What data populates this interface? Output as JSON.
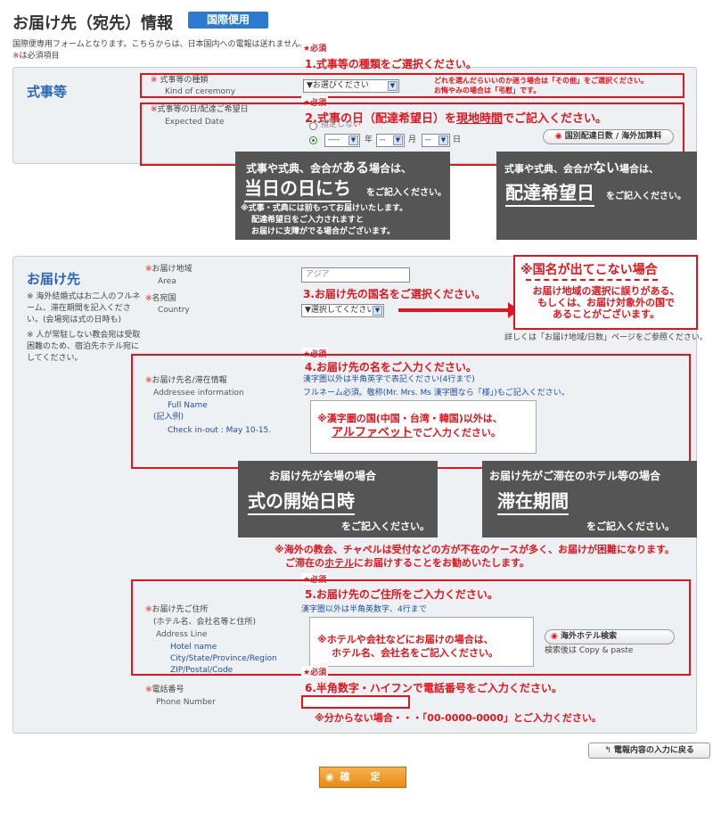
{
  "header": {
    "title": "お届け先（宛先）情報",
    "badge": "国際便用",
    "description": "国際便専用フォームとなります。こちらからは、日本国内への電報は送れません。",
    "required_mark": "※",
    "required_note": "は必須項目"
  },
  "ceremony_section": {
    "title": "式事等",
    "kind": {
      "mark": "※",
      "label": "式事等の種類",
      "label_en": "Kind of ceremony",
      "select_value": "▼お選びください",
      "hint_line1": "どれを選んだらいいのか迷う場合は「その他」をご選択ください。",
      "hint_line2": "お悔やみの場合は「弔慰」です。"
    },
    "date": {
      "mark": "※",
      "label": "式事等の日/配達ご希望日",
      "label_en": "Expected Date",
      "radio1_label": "指定しない",
      "year_value": "----",
      "year_unit": "年",
      "month_value": "--",
      "month_unit": "月",
      "day_value": "--",
      "day_unit": "日",
      "delivery_days_button": "国別配達日数 / 海外加算料"
    }
  },
  "annotations": {
    "hissu": "★必須",
    "step1": "1.式事等の種類をご選択ください。",
    "step2_a": "2.式事の日（配達希望日）を",
    "step2_b": "現地時間",
    "step2_c": "でご記入ください。",
    "box_a_line1_a": "式事や式典、会合が",
    "box_a_line1_b": "ある",
    "box_a_line1_c": "場合は、",
    "box_a_big": "当日の日にち",
    "box_a_small": "をご記入ください。",
    "box_a_note1": "※式事・式典には前もってお届けいたします。",
    "box_a_note2": "配達希望日をご入力されますと",
    "box_a_note3": "お届けに支障がでる場合がございます。",
    "box_b_line1_a": "式事や式典、会合が",
    "box_b_line1_b": "ない",
    "box_b_line1_c": "場合は、",
    "box_b_big": "配達希望日",
    "box_b_small": "をご記入ください。",
    "step3": "3.お届け先の国名をご選択ください。",
    "country_box_title": "※国名が出てこない場合",
    "country_box_line1": "お届け地域の選択に誤りがある、",
    "country_box_line2": "もしくは、お届け対象外の国で",
    "country_box_line3": "あることがございます。",
    "step4": "4.お届け先の名をご入力ください。",
    "kanji_note_a": "※漢字圏の国(中国・台湾・韓国)以外は、",
    "kanji_note_b": "アルファベット",
    "kanji_note_c": "でご入力ください。",
    "venue_title": "お届け先が会場の場合",
    "venue_big": "式の開始日時",
    "venue_small": "をご記入ください。",
    "hotel_title": "お届け先がご滞在のホテル等の場合",
    "hotel_big": "滞在期間",
    "hotel_small": "をご記入ください。",
    "church_note1": "※海外の教会、チャペルは受付などの方が不在のケースが多く、お届けが困難になります。",
    "church_note2_a": "ご滞在の",
    "church_note2_b": "ホテル",
    "church_note2_c": "にお届けすることをお勧めいたします。",
    "step5": "5.お届け先のご住所をご入力ください。",
    "address_note1": "※ホテルや会社などにお届けの場合は、",
    "address_note2": "ホテル名、会社名をご記入ください。",
    "step6": "6.半角数字・ハイフンで電話番号をご入力ください。",
    "phone_note": "※分からない場合・・・「00-0000-0000」とご入力ください。"
  },
  "destination_section": {
    "title": "お届け先",
    "side_note1": "※ 海外結婚式はお二人のフルネーム、滞在期間を記入ください。(会場宛は式の日時も)",
    "side_note2": "※ 人が常駐しない教会宛は受取困難のため、宿泊先ホテル宛にしてください。",
    "area": {
      "mark": "※",
      "label": "お届け地域",
      "label_en": "Area",
      "value": "アジア"
    },
    "country": {
      "mark": "※",
      "label": "名宛国",
      "label_en": "Country",
      "select_value": "▼選択してください",
      "link_text": "詳しくは「お届け地域/日数」ページをご参照ください。"
    },
    "addressee": {
      "mark": "※",
      "label": "お届け先名/滞在情報",
      "label_en": "Addressee information",
      "sub1": "Full Name",
      "sub2": "(記入例)",
      "sub3": "Check in-out : May 10-15.",
      "hint1": "漢字圏以外は半角英字で表記ください(4行まで)",
      "hint2": "フルネーム必須。敬称(Mr. Mrs. Ms  漢字圏なら「様」)もご記入ください。"
    },
    "address": {
      "mark": "※",
      "label": "お届け先ご住所",
      "label2": "(ホテル名、会社名等と住所)",
      "label_en": "Address Line",
      "sub1": "Hotel name",
      "sub2": "City/State/Province/Region",
      "sub3": "ZIP/Postal/Code",
      "hint": "漢字圏以外は半角英数字、4行まで",
      "search_button": "海外ホテル検索",
      "search_note": "検索後は Copy & paste"
    },
    "phone": {
      "mark": "※",
      "label": "電話番号",
      "label_en": "Phone Number",
      "value": ""
    }
  },
  "footer": {
    "back_button": "電報内容の入力に戻る",
    "confirm_button": "確　定"
  }
}
